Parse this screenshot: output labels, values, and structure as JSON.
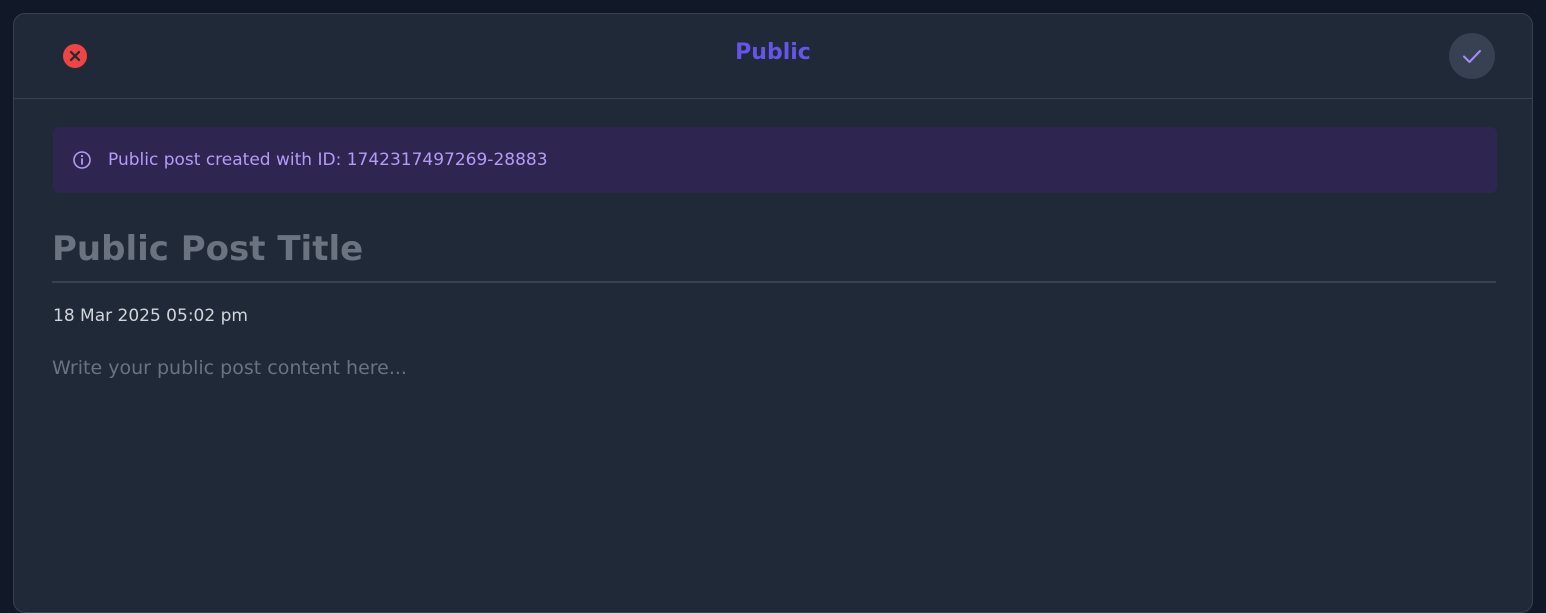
{
  "header": {
    "title": "Public",
    "close_icon": "x-circle-icon",
    "confirm_icon": "check-icon"
  },
  "alert": {
    "icon": "info-icon",
    "message": "Public post created with ID: 1742317497269-28883"
  },
  "post": {
    "title_placeholder": "Public Post Title",
    "title_value": "",
    "timestamp": "18 Mar 2025 05:02 pm",
    "content_placeholder": "Write your public post content here...",
    "content_value": ""
  },
  "colors": {
    "page_bg": "#111827",
    "modal_bg": "#1f2937",
    "accent": "#7c3aed",
    "close": "#ef4444",
    "alert_bg": "#2e2550",
    "alert_text": "#b49cf5"
  }
}
